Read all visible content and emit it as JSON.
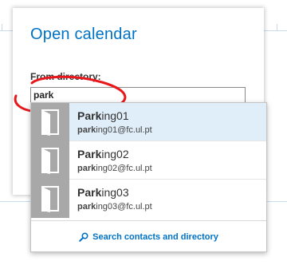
{
  "dialog": {
    "title": "Open calendar",
    "directory_label": "From directory:",
    "search_value": "park"
  },
  "results": [
    {
      "name_match": "Park",
      "name_rest": "ing01",
      "email_match": "park",
      "email_rest": "ing01@fc.ul.pt",
      "selected": true
    },
    {
      "name_match": "Park",
      "name_rest": "ing02",
      "email_match": "park",
      "email_rest": "ing02@fc.ul.pt",
      "selected": false
    },
    {
      "name_match": "Park",
      "name_rest": "ing03",
      "email_match": "park",
      "email_rest": "ing03@fc.ul.pt",
      "selected": false
    }
  ],
  "search_link": {
    "label": "Search contacts and directory",
    "icon": "magnifier-icon"
  },
  "colors": {
    "accent": "#0072c6",
    "selected_row": "#e0eef9",
    "avatar_bg": "#a8a8a8",
    "annotation_red": "#e8171c"
  }
}
